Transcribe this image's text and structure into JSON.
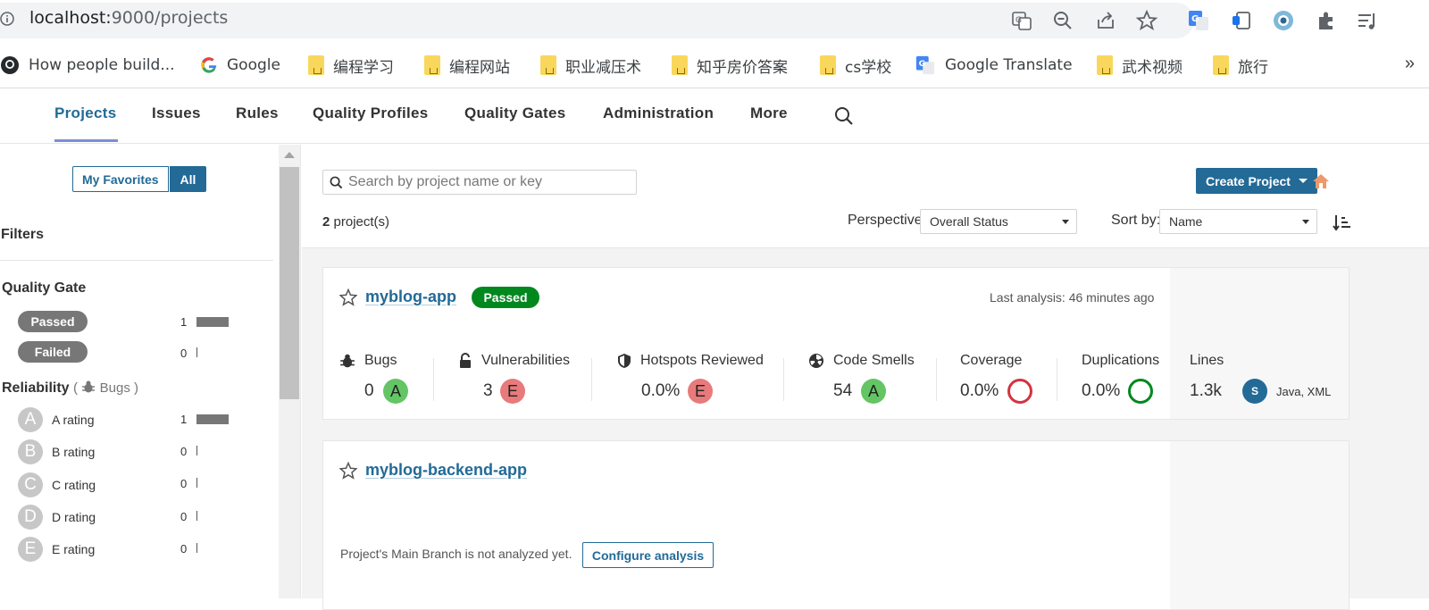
{
  "browser": {
    "url_host": "localhost:",
    "url_port_path": "9000/projects",
    "bookmarks": [
      {
        "label": "How people build...",
        "icon": "github-icon"
      },
      {
        "label": "Google",
        "icon": "google-icon"
      },
      {
        "label": "编程学习",
        "icon": "folder-icon"
      },
      {
        "label": "编程网站",
        "icon": "folder-icon"
      },
      {
        "label": "职业减压术",
        "icon": "folder-icon"
      },
      {
        "label": "知乎房价答案",
        "icon": "folder-icon"
      },
      {
        "label": "cs学校",
        "icon": "folder-icon"
      },
      {
        "label": "Google Translate",
        "icon": "google-translate-icon"
      },
      {
        "label": "武术视频",
        "icon": "folder-icon"
      },
      {
        "label": "旅行",
        "icon": "folder-icon"
      }
    ],
    "more_bookmarks": "»"
  },
  "nav": {
    "items": [
      "Projects",
      "Issues",
      "Rules",
      "Quality Profiles",
      "Quality Gates",
      "Administration",
      "More"
    ],
    "active": "Projects"
  },
  "sidebar": {
    "favorites_label": "My Favorites",
    "all_label": "All",
    "filters_title": "Filters",
    "quality_gate": {
      "title": "Quality Gate",
      "items": [
        {
          "label": "Passed",
          "count": "1"
        },
        {
          "label": "Failed",
          "count": "0"
        }
      ]
    },
    "reliability": {
      "title": "Reliability",
      "subtitle": "( ",
      "subtitle_bugs": "Bugs )",
      "items": [
        {
          "letter": "A",
          "label": "A rating",
          "count": "1"
        },
        {
          "letter": "B",
          "label": "B rating",
          "count": "0"
        },
        {
          "letter": "C",
          "label": "C rating",
          "count": "0"
        },
        {
          "letter": "D",
          "label": "D rating",
          "count": "0"
        },
        {
          "letter": "E",
          "label": "E rating",
          "count": "0"
        }
      ]
    }
  },
  "toolbar": {
    "search_placeholder": "Search by project name or key",
    "create_label": "Create Project",
    "project_count": "2",
    "project_count_suffix": " project(s)",
    "perspective_label": "Perspective:",
    "perspective_value": "Overall Status",
    "sort_label": "Sort by:",
    "sort_value": "Name"
  },
  "projects": [
    {
      "name": "myblog-app",
      "quality_gate": "Passed",
      "last_analysis": "Last analysis: 46 minutes ago",
      "metrics": {
        "bugs": {
          "label": "Bugs",
          "value": "0",
          "rating": "A"
        },
        "vulnerabilities": {
          "label": "Vulnerabilities",
          "value": "3",
          "rating": "E"
        },
        "hotspots": {
          "label": "Hotspots Reviewed",
          "value": "0.0%",
          "rating": "E"
        },
        "code_smells": {
          "label": "Code Smells",
          "value": "54",
          "rating": "A"
        },
        "coverage": {
          "label": "Coverage",
          "value": "0.0%"
        },
        "duplications": {
          "label": "Duplications",
          "value": "0.0%"
        },
        "lines": {
          "label": "Lines",
          "value": "1.3k",
          "badge": "S",
          "languages": "Java, XML"
        }
      }
    },
    {
      "name": "myblog-backend-app",
      "not_analyzed": "Project's Main Branch is not analyzed yet.",
      "configure_label": "Configure analysis"
    }
  ],
  "colors": {
    "brand_blue": "#236a97",
    "passed_green": "#00881f",
    "rating_a": "#64c565",
    "rating_e": "#e87a7c",
    "coverage_red": "#d4333f",
    "duplication_green": "#00881f"
  }
}
